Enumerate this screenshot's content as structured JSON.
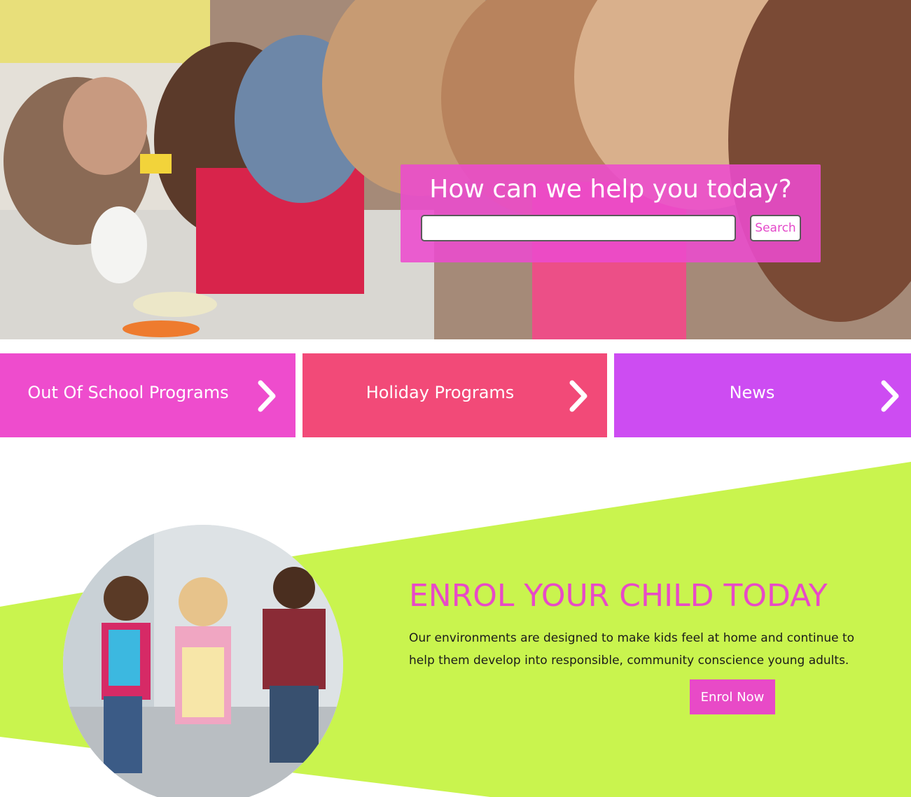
{
  "hero": {
    "photo_alt": "children-crafting-at-table",
    "help_box": {
      "title": "How can we help you today?",
      "search_value": "",
      "search_placeholder": "",
      "search_button_label": "Search"
    }
  },
  "tiles": [
    {
      "label": "Out Of School Programs",
      "color": "#ee4ccd",
      "icon": "chevron-right-icon"
    },
    {
      "label": "Holiday Programs",
      "color": "#f24a78",
      "icon": "chevron-right-icon"
    },
    {
      "label": "News",
      "color": "#cd4cf2",
      "icon": "chevron-right-icon"
    }
  ],
  "enrol": {
    "title": "ENROL YOUR CHILD TODAY",
    "text": "Our environments are designed to make kids feel at home and continue to help them develop into responsible, community conscience young adults.",
    "button_label": "Enrol Now",
    "photo_alt": "children-running-with-backpacks",
    "accent_color": "#e84ac7",
    "background_color": "#c9f44e"
  }
}
